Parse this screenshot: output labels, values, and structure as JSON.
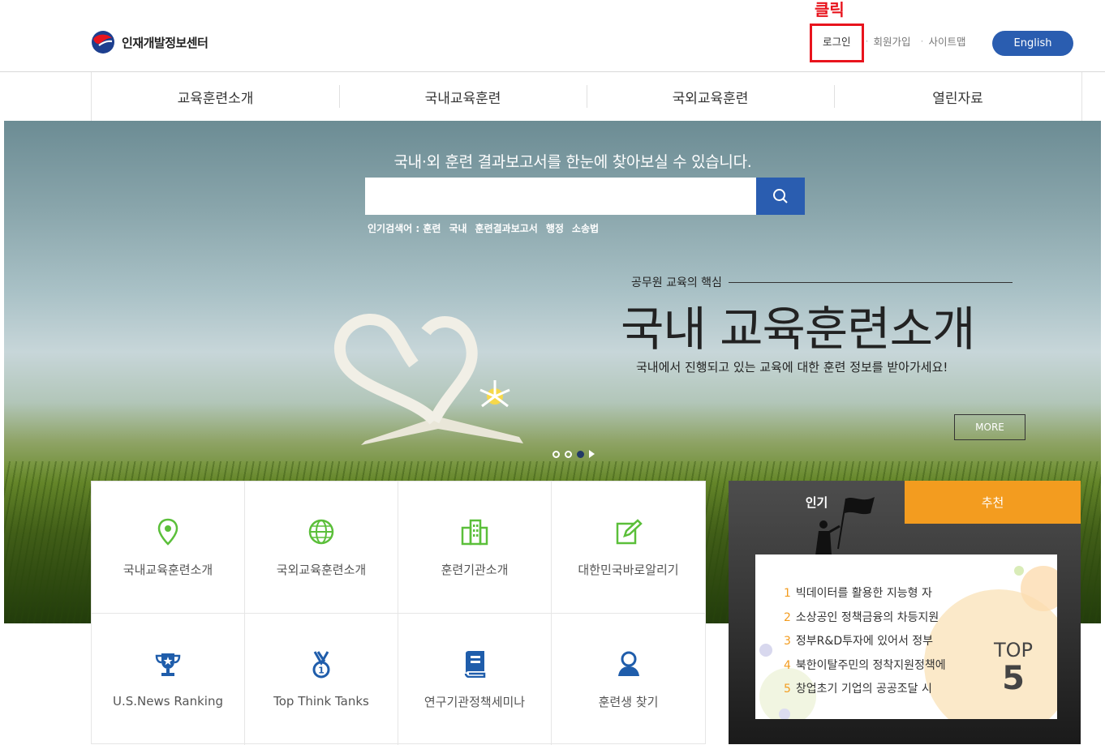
{
  "header": {
    "logo_text": "인재개발정보센터",
    "util_links": [
      "로그인",
      "회원가입",
      "사이트맵"
    ],
    "english_label": "English",
    "annotation": "클릭"
  },
  "gnb": [
    "교육훈련소개",
    "국내교육훈련",
    "국외교육훈련",
    "열린자료"
  ],
  "hero": {
    "headline": "국내·외 훈련 결과보고서를 한눈에 찾아보실 수 있습니다.",
    "search_value": "",
    "popular_label": "인기검색어 : 훈련",
    "popular_keywords": [
      "국내",
      "훈련결과보고서",
      "행정",
      "소송법"
    ],
    "slide_sub": "공무원 교육의 핵심",
    "slide_title": "국내 교육훈련소개",
    "slide_desc": "국내에서 진행되고 있는 교육에 대한 훈련 정보를 받아가세요!",
    "more_label": "MORE"
  },
  "quick_menu": [
    {
      "label": "국내교육훈련소개",
      "icon": "location-pin-icon"
    },
    {
      "label": "국외교육훈련소개",
      "icon": "globe-icon"
    },
    {
      "label": "훈련기관소개",
      "icon": "building-icon"
    },
    {
      "label": "대한민국바로알리기",
      "icon": "edit-icon"
    },
    {
      "label": "U.S.News Ranking",
      "icon": "trophy-icon"
    },
    {
      "label": "Top Think Tanks",
      "icon": "medal-icon"
    },
    {
      "label": "연구기관정책세미나",
      "icon": "book-icon"
    },
    {
      "label": "훈련생 찾기",
      "icon": "person-icon"
    }
  ],
  "ranking": {
    "tab_popular": "인기",
    "tab_recommend": "추천",
    "items": [
      {
        "num": "1",
        "text": "빅데이터를 활용한 지능형 자"
      },
      {
        "num": "2",
        "text": "소상공인 정책금융의 차등지원"
      },
      {
        "num": "3",
        "text": "정부R&D투자에 있어서 정부"
      },
      {
        "num": "4",
        "text": "북한이탈주민의 정착지원정책에"
      },
      {
        "num": "5",
        "text": "창업초기 기업의 공공조달 시"
      }
    ],
    "top_label": "TOP",
    "top_num": "5"
  },
  "colors": {
    "accent": "#2a5db0",
    "orange": "#f39c1f",
    "annotation_red": "#e8141d"
  }
}
